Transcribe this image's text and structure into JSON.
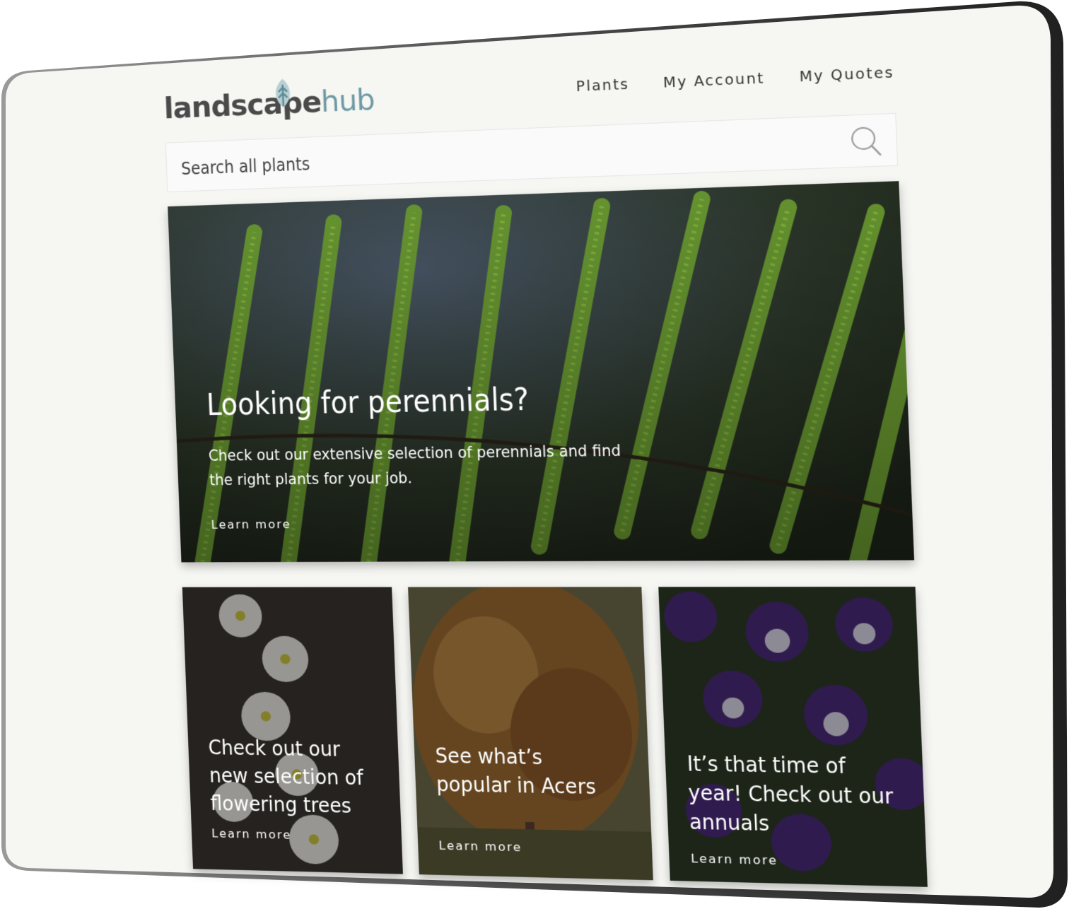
{
  "logo": {
    "part1": "landscape",
    "part2": "hub"
  },
  "nav": {
    "items": [
      "Plants",
      "My Account",
      "My Quotes"
    ]
  },
  "search": {
    "placeholder": "Search all plants"
  },
  "hero": {
    "title": "Looking for perennials?",
    "body": "Check out our extensive selection of perennials and find the right plants for your job.",
    "link": "Learn more"
  },
  "cards": [
    {
      "title": "Check out our new selection of flowering trees",
      "link": "Learn more"
    },
    {
      "title": "See what’s popular in Acers",
      "link": "Learn more"
    },
    {
      "title": "It’s that time of year! Check out our annuals",
      "link": "Learn more"
    }
  ],
  "colors": {
    "brand_dark": "#4a4a4a",
    "brand_accent": "#6e9aa3",
    "screen_bg": "#f6f6f3"
  }
}
